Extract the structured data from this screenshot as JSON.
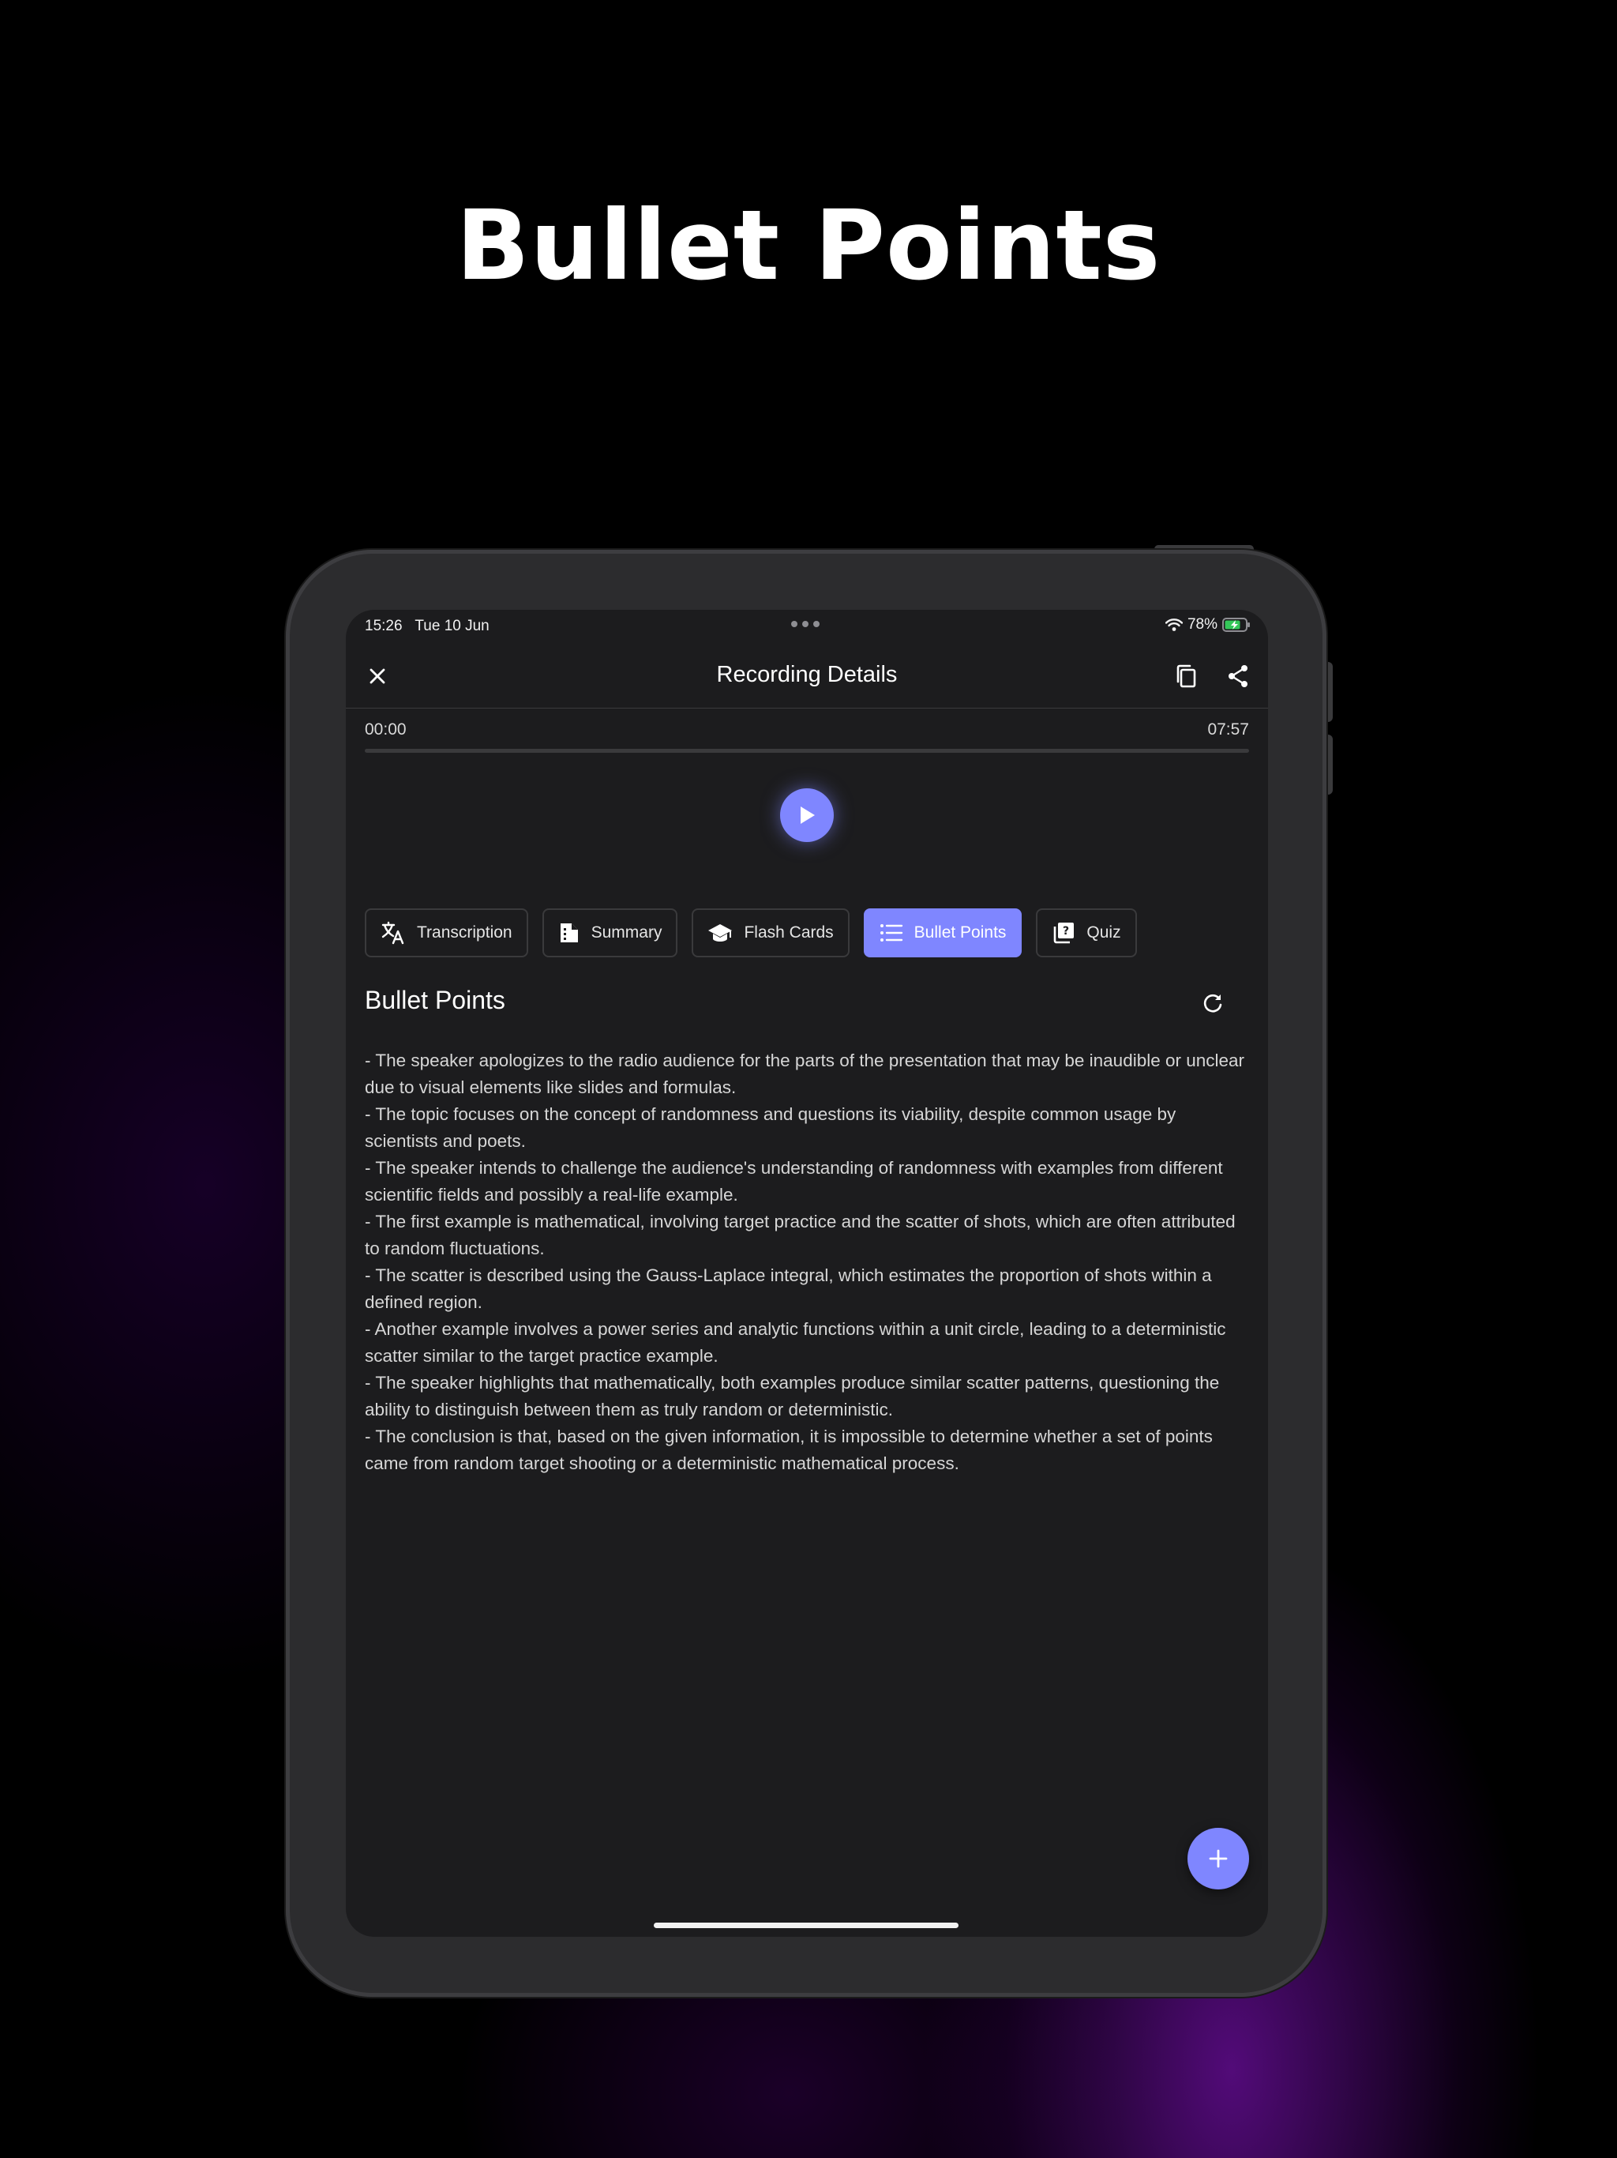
{
  "headline": "Bullet Points",
  "colors": {
    "accent": "#7f86ff",
    "screen_bg": "#1c1c1e",
    "page_bg": "#000000"
  },
  "status_bar": {
    "time": "15:26",
    "date": "Tue 10 Jun",
    "battery": "78%"
  },
  "nav": {
    "title": "Recording Details",
    "close_icon": "close-icon",
    "copy_icon": "copy-icon",
    "share_icon": "share-icon"
  },
  "player": {
    "current": "00:00",
    "duration": "07:57",
    "progress": 0
  },
  "tabs": [
    {
      "label": "Transcription",
      "icon": "translate-icon",
      "active": false
    },
    {
      "label": "Summary",
      "icon": "document-icon",
      "active": false
    },
    {
      "label": "Flash Cards",
      "icon": "graduation-cap-icon",
      "active": false
    },
    {
      "label": "Bullet Points",
      "icon": "list-icon",
      "active": true
    },
    {
      "label": "Quiz",
      "icon": "quiz-icon",
      "active": false
    }
  ],
  "section": {
    "title": "Bullet Points"
  },
  "bullets": [
    "- The speaker apologizes to the radio audience for the parts of the presentation that may be inaudible or unclear due to visual elements like slides and formulas.",
    "- The topic focuses on the concept of randomness and questions its viability, despite common usage by scientists and poets.",
    "- The speaker intends to challenge the audience's understanding of randomness with examples from different scientific fields and possibly a real-life example.",
    "- The first example is mathematical, involving target practice and the scatter of shots, which are often attributed to random fluctuations.",
    "- The scatter is described using the Gauss-Laplace integral, which estimates the proportion of shots within a defined region.",
    "- Another example involves a power series and analytic functions within a unit circle, leading to a deterministic scatter similar to the target practice example.",
    "- The speaker highlights that mathematically, both examples produce similar scatter patterns, questioning the ability to distinguish between them as truly random or deterministic.",
    "- The conclusion is that, based on the given information, it is impossible to determine whether a set of points came from random target shooting or a deterministic mathematical process."
  ]
}
